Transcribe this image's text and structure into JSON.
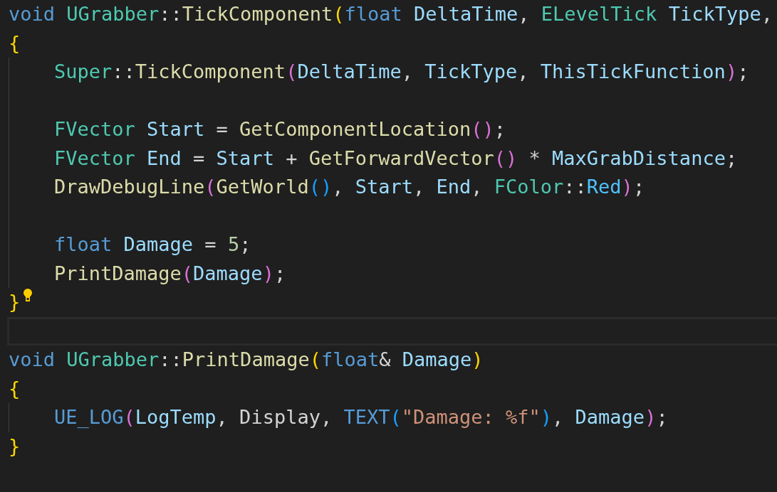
{
  "lines": [
    {
      "indented": false,
      "tokens": [
        {
          "text": "void ",
          "kind": "kw"
        },
        {
          "text": "UGrabber",
          "kind": "type"
        },
        {
          "text": "::",
          "kind": "plain"
        },
        {
          "text": "TickComponent",
          "kind": "fn"
        },
        {
          "text": "(",
          "kind": "b1"
        },
        {
          "text": "float ",
          "kind": "kw"
        },
        {
          "text": "DeltaTime",
          "kind": "var"
        },
        {
          "text": ", ",
          "kind": "plain"
        },
        {
          "text": "ELevelTick ",
          "kind": "type"
        },
        {
          "text": "TickType",
          "kind": "var"
        },
        {
          "text": ",",
          "kind": "plain"
        }
      ]
    },
    {
      "indented": false,
      "tokens": [
        {
          "text": "{",
          "kind": "b1"
        }
      ]
    },
    {
      "indented": true,
      "tokens": [
        {
          "text": "Super",
          "kind": "type"
        },
        {
          "text": "::",
          "kind": "plain"
        },
        {
          "text": "TickComponent",
          "kind": "fn"
        },
        {
          "text": "(",
          "kind": "b2"
        },
        {
          "text": "DeltaTime",
          "kind": "var"
        },
        {
          "text": ", ",
          "kind": "plain"
        },
        {
          "text": "TickType",
          "kind": "var"
        },
        {
          "text": ", ",
          "kind": "plain"
        },
        {
          "text": "ThisTickFunction",
          "kind": "var"
        },
        {
          "text": ")",
          "kind": "b2"
        },
        {
          "text": ";",
          "kind": "plain"
        }
      ]
    },
    {
      "indented": true
    },
    {
      "indented": true,
      "tokens": [
        {
          "text": "FVector ",
          "kind": "type"
        },
        {
          "text": "Start",
          "kind": "var"
        },
        {
          "text": " = ",
          "kind": "plain"
        },
        {
          "text": "GetComponentLocation",
          "kind": "fn"
        },
        {
          "text": "()",
          "kind": "b2"
        },
        {
          "text": ";",
          "kind": "plain"
        }
      ]
    },
    {
      "indented": true,
      "tokens": [
        {
          "text": "FVector ",
          "kind": "type"
        },
        {
          "text": "End",
          "kind": "var"
        },
        {
          "text": " = ",
          "kind": "plain"
        },
        {
          "text": "Start",
          "kind": "var"
        },
        {
          "text": " + ",
          "kind": "plain"
        },
        {
          "text": "GetForwardVector",
          "kind": "fn"
        },
        {
          "text": "()",
          "kind": "b2"
        },
        {
          "text": " * ",
          "kind": "plain"
        },
        {
          "text": "MaxGrabDistance",
          "kind": "var"
        },
        {
          "text": ";",
          "kind": "plain"
        }
      ]
    },
    {
      "indented": true,
      "tokens": [
        {
          "text": "DrawDebugLine",
          "kind": "fn"
        },
        {
          "text": "(",
          "kind": "b2"
        },
        {
          "text": "GetWorld",
          "kind": "fn"
        },
        {
          "text": "()",
          "kind": "b3"
        },
        {
          "text": ", ",
          "kind": "plain"
        },
        {
          "text": "Start",
          "kind": "var"
        },
        {
          "text": ", ",
          "kind": "plain"
        },
        {
          "text": "End",
          "kind": "var"
        },
        {
          "text": ", ",
          "kind": "plain"
        },
        {
          "text": "FColor",
          "kind": "type"
        },
        {
          "text": "::",
          "kind": "plain"
        },
        {
          "text": "Red",
          "kind": "member"
        },
        {
          "text": ")",
          "kind": "b2"
        },
        {
          "text": ";",
          "kind": "plain"
        }
      ]
    },
    {
      "indented": true
    },
    {
      "indented": true,
      "tokens": [
        {
          "text": "float ",
          "kind": "kw"
        },
        {
          "text": "Damage",
          "kind": "var"
        },
        {
          "text": " = ",
          "kind": "plain"
        },
        {
          "text": "5",
          "kind": "num"
        },
        {
          "text": ";",
          "kind": "plain"
        }
      ]
    },
    {
      "indented": true,
      "tokens": [
        {
          "text": "PrintDamage",
          "kind": "fn"
        },
        {
          "text": "(",
          "kind": "b2"
        },
        {
          "text": "Damage",
          "kind": "var"
        },
        {
          "text": ")",
          "kind": "b2"
        },
        {
          "text": ";",
          "kind": "plain"
        }
      ]
    },
    {
      "indented": false,
      "lightbulb": true,
      "tokens": [
        {
          "text": "}",
          "kind": "b1"
        }
      ]
    },
    {
      "indented": false,
      "current": true
    },
    {
      "indented": false,
      "tokens": [
        {
          "text": "void ",
          "kind": "kw"
        },
        {
          "text": "UGrabber",
          "kind": "type"
        },
        {
          "text": "::",
          "kind": "plain"
        },
        {
          "text": "PrintDamage",
          "kind": "fn"
        },
        {
          "text": "(",
          "kind": "b1"
        },
        {
          "text": "float",
          "kind": "kw"
        },
        {
          "text": "& ",
          "kind": "plain"
        },
        {
          "text": "Damage",
          "kind": "var"
        },
        {
          "text": ")",
          "kind": "b1"
        }
      ]
    },
    {
      "indented": false,
      "tokens": [
        {
          "text": "{",
          "kind": "b1"
        }
      ]
    },
    {
      "indented": true,
      "tokens": [
        {
          "text": "UE_LOG",
          "kind": "macro"
        },
        {
          "text": "(",
          "kind": "b2"
        },
        {
          "text": "LogTemp",
          "kind": "var"
        },
        {
          "text": ", Display, ",
          "kind": "plain"
        },
        {
          "text": "TEXT",
          "kind": "macro"
        },
        {
          "text": "(",
          "kind": "b3"
        },
        {
          "text": "\"Damage: %f\"",
          "kind": "str"
        },
        {
          "text": ")",
          "kind": "b3"
        },
        {
          "text": ", ",
          "kind": "plain"
        },
        {
          "text": "Damage",
          "kind": "var"
        },
        {
          "text": ")",
          "kind": "b2"
        },
        {
          "text": ";",
          "kind": "plain"
        }
      ]
    },
    {
      "indented": false,
      "tokens": [
        {
          "text": "}",
          "kind": "b1"
        }
      ]
    }
  ]
}
